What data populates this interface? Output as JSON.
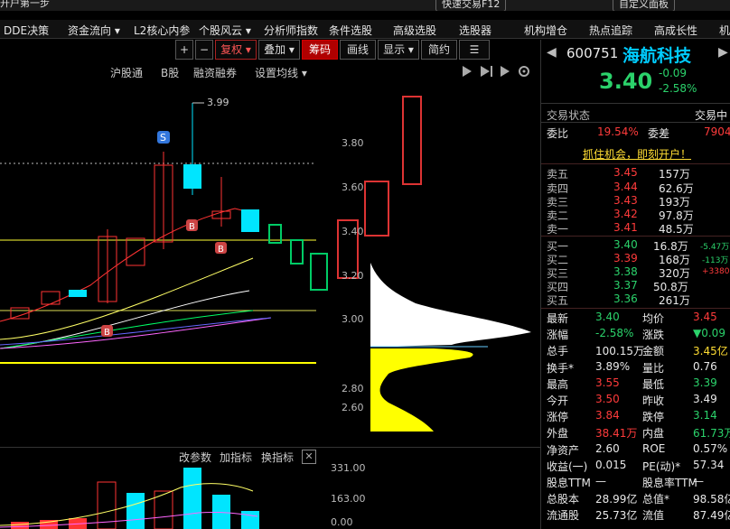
{
  "topbar": {
    "left_text": "开户第一步",
    "quick_trade": "快速交易F12",
    "custom_panel": "自定义面板"
  },
  "menubar": [
    "DDE决策",
    "资金流向 ▾",
    "L2核心内参",
    "个股风云 ▾",
    "分析师指数",
    "条件选股",
    "高级选股",
    "选股器",
    "机构增仓",
    "热点追踪",
    "高成长性",
    "机"
  ],
  "toolbar": {
    "plus": "+",
    "minus": "−",
    "fuquan": "复权 ▾",
    "diejia": "叠加 ▾",
    "chouma": "筹码",
    "huaxian": "画线",
    "xianshi": "显示 ▾",
    "jianyue": "简约",
    "more": "☰"
  },
  "chart_header": {
    "hutong": "沪股通",
    "bgu": "B股",
    "rongzi": "融资融券",
    "junxian": "设置均线 ▾"
  },
  "price_axis": [
    "3.80",
    "3.60",
    "3.40",
    "3.20",
    "3.00",
    "2.80",
    "2.60"
  ],
  "annotations": {
    "high_label": "3.99",
    "s_badge": "S",
    "b_badge": "B"
  },
  "volume": {
    "header": [
      "改参数",
      "加指标",
      "换指标"
    ],
    "axis": [
      "331.00",
      "163.00",
      "0.00"
    ]
  },
  "colors": {
    "up": "#ff3b3b",
    "down": "#00e5ff",
    "buy_zone": "#ffff00",
    "bg": "#000000"
  },
  "stock": {
    "code": "600751",
    "name": "海航科技",
    "price": "3.40",
    "change": "-0.09",
    "change_pct": "-2.58%",
    "status_label": "交易状态",
    "status_value": "交易中",
    "weibi_label": "委比",
    "weibi_value": "19.54%",
    "weicha_label": "委差",
    "weicha_value": "7904",
    "ad_text": "抓住机会，即刻开户！"
  },
  "sell_book": [
    {
      "label": "卖五",
      "price": "3.45",
      "vol": "157万"
    },
    {
      "label": "卖四",
      "price": "3.44",
      "vol": "62.6万"
    },
    {
      "label": "卖三",
      "price": "3.43",
      "vol": "193万"
    },
    {
      "label": "卖二",
      "price": "3.42",
      "vol": "97.8万"
    },
    {
      "label": "卖一",
      "price": "3.41",
      "vol": "48.5万"
    }
  ],
  "buy_book": [
    {
      "label": "买一",
      "price": "3.40",
      "vol": "16.8万",
      "chg": "-5.47万"
    },
    {
      "label": "买二",
      "price": "3.39",
      "vol": "168万",
      "chg": "-113万"
    },
    {
      "label": "买三",
      "price": "3.38",
      "vol": "320万",
      "chg": "+3380"
    },
    {
      "label": "买四",
      "price": "3.37",
      "vol": "50.8万",
      "chg": ""
    },
    {
      "label": "买五",
      "price": "3.36",
      "vol": "261万",
      "chg": ""
    }
  ],
  "stats": [
    {
      "l1": "最新",
      "v1": "3.40",
      "c1": "green",
      "l2": "均价",
      "v2": "3.45",
      "c2": "red"
    },
    {
      "l1": "涨幅",
      "v1": "-2.58%",
      "c1": "green",
      "l2": "涨跌",
      "v2": "▼0.09",
      "c2": "green"
    },
    {
      "l1": "总手",
      "v1": "100.15万",
      "c1": "white",
      "l2": "金额",
      "v2": "3.45亿",
      "c2": "yellow"
    },
    {
      "l1": "换手*",
      "v1": "3.89%",
      "c1": "white",
      "l2": "量比",
      "v2": "0.76",
      "c2": "white"
    },
    {
      "l1": "最高",
      "v1": "3.55",
      "c1": "red",
      "l2": "最低",
      "v2": "3.39",
      "c2": "green"
    },
    {
      "l1": "今开",
      "v1": "3.50",
      "c1": "red",
      "l2": "昨收",
      "v2": "3.49",
      "c2": "white"
    },
    {
      "l1": "涨停",
      "v1": "3.84",
      "c1": "red",
      "l2": "跌停",
      "v2": "3.14",
      "c2": "green"
    },
    {
      "l1": "外盘",
      "v1": "38.41万",
      "c1": "red",
      "l2": "内盘",
      "v2": "61.73万",
      "c2": "green"
    },
    {
      "l1": "净资产",
      "v1": "2.60",
      "c1": "white",
      "l2": "ROE",
      "v2": "0.57%",
      "c2": "white"
    },
    {
      "l1": "收益(一)",
      "v1": "0.015",
      "c1": "white",
      "l2": "PE(动)*",
      "v2": "57.34",
      "c2": "white"
    },
    {
      "l1": "股息TTM",
      "v1": "—",
      "c1": "white",
      "l2": "股息率TTM",
      "v2": "—",
      "c2": "white"
    },
    {
      "l1": "总股本",
      "v1": "28.99亿",
      "c1": "white",
      "l2": "总值*",
      "v2": "98.58亿",
      "c2": "white"
    },
    {
      "l1": "流通股",
      "v1": "25.73亿",
      "c1": "white",
      "l2": "流值",
      "v2": "87.49亿",
      "c2": "white"
    }
  ]
}
